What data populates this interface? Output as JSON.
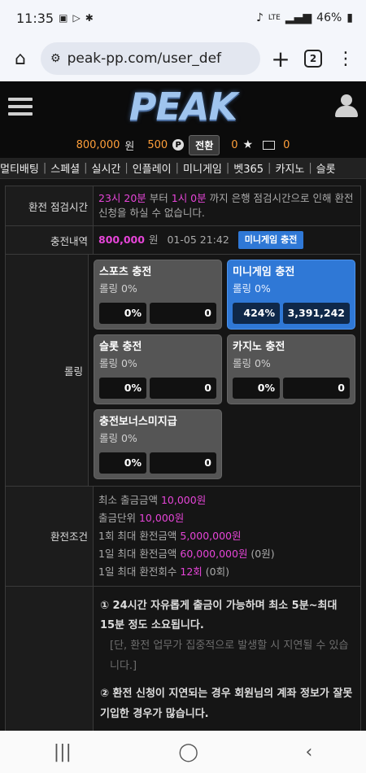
{
  "statusbar": {
    "time": "11:35",
    "network": "LTE",
    "battery": "46%"
  },
  "browser": {
    "url": "peak-pp.com/user_def",
    "tab_count": "2"
  },
  "site": {
    "logo": "PEAK",
    "balance": {
      "money": "800,000",
      "money_unit": "원",
      "points": "500",
      "point_badge": "P",
      "switch_label": "전환",
      "stars": "0",
      "messages": "0"
    },
    "nav": [
      "멀티배팅",
      "스페셜",
      "실시간",
      "인플레이",
      "미니게임",
      "벳365",
      "카지노",
      "슬롯"
    ]
  },
  "withdraw": {
    "maintenance": {
      "label": "환전 점검시간",
      "time1": "23시 20분",
      "text1": " 부터 ",
      "time2": "1시 0분",
      "text2": " 까지 은행 점검시간으로 인해 환전신청을 하실 수 없습니다."
    },
    "history": {
      "label": "충전내역",
      "amount": "800,000",
      "unit": "원",
      "date": "01-05 21:42",
      "button": "미니게임 충전"
    },
    "rolling": {
      "label": "롤링",
      "cards": [
        {
          "title": "스포츠 충전",
          "rolling": "롤링 0%",
          "pct": "0%",
          "amount": "0",
          "active": false
        },
        {
          "title": "미니게임 충전",
          "rolling": "롤링 0%",
          "pct": "424%",
          "amount": "3,391,242",
          "active": true
        },
        {
          "title": "슬롯 충전",
          "rolling": "롤링 0%",
          "pct": "0%",
          "amount": "0",
          "active": false
        },
        {
          "title": "카지노 충전",
          "rolling": "롤링 0%",
          "pct": "0%",
          "amount": "0",
          "active": false
        },
        {
          "title": "충전보너스미지급",
          "rolling": "롤링 0%",
          "pct": "0%",
          "amount": "0",
          "active": false
        }
      ]
    },
    "conditions": {
      "label": "환전조건",
      "lines": [
        {
          "text": "최소 출금금액 ",
          "value": "10,000원",
          "suffix": ""
        },
        {
          "text": "출금단위 ",
          "value": "10,000원",
          "suffix": ""
        },
        {
          "text": "1회 최대 환전금액 ",
          "value": "5,000,000원",
          "suffix": ""
        },
        {
          "text": "1일 최대 환전금액 ",
          "value": "60,000,000원",
          "suffix": " (0원)"
        },
        {
          "text": "1일 최대 환전회수 ",
          "value": "12회",
          "suffix": " (0회)"
        }
      ]
    },
    "notice": {
      "p1": "① 24시간 자유롭게 출금이 가능하며 최소 5분~최대 15분 정도 소요됩니다.",
      "p1_note": "[단, 환전 업무가 집중적으로 발생할 시 지연될 수 있습니다.]",
      "p2": "② 환전 신청이 지연되는 경우 회원님의 계좌 정보가 잘못 기입한 경우가 많습니다."
    }
  },
  "colors": {
    "accent_blue": "#2f78d6",
    "magenta": "#e645d8",
    "orange": "#ff9f3a"
  }
}
